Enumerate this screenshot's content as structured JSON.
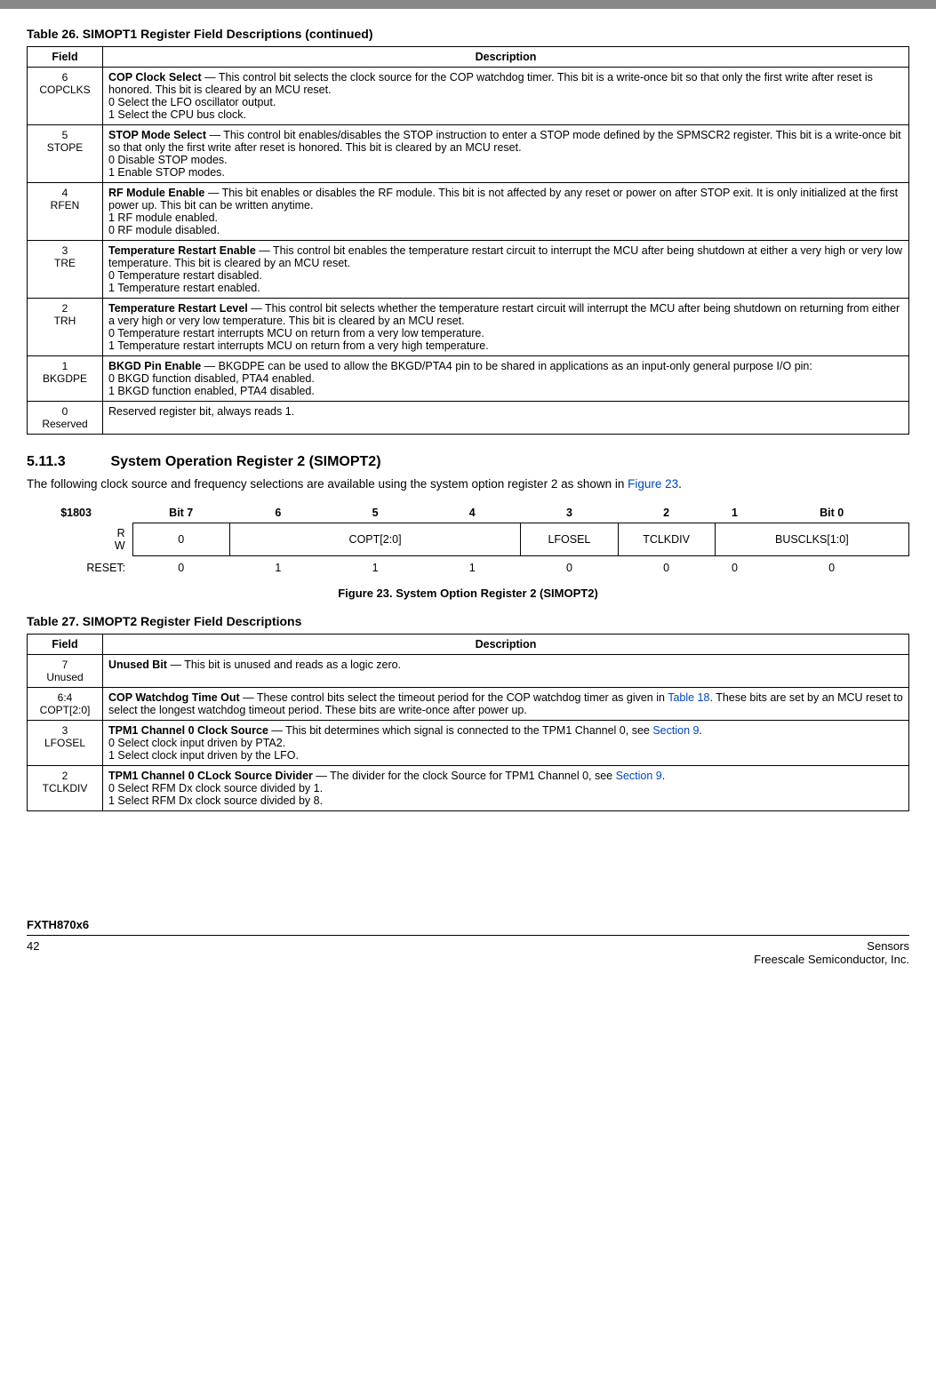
{
  "topbar_title": "",
  "table26_title": "Table 26. SIMOPT1 Register Field Descriptions (continued)",
  "table26_head_field": "Field",
  "table26_head_desc": "Description",
  "rows26": [
    {
      "bit": "6",
      "name": "COPCLKS",
      "title": "COP Clock Select",
      "text": " — This control bit selects the clock source for the COP watchdog timer. This bit is a write-once bit so that only the first write after reset is honored. This bit is cleared by an MCU reset.",
      "opt0": "0   Select the LFO oscillator output.",
      "opt1": "1   Select the CPU bus clock."
    },
    {
      "bit": "5",
      "name": "STOPE",
      "title": "STOP Mode Select",
      "text": " — This control bit enables/disables the STOP instruction to enter a STOP mode defined by the SPMSCR2 register. This bit is a write-once bit so that only the first write after reset is honored. This bit is cleared by an MCU reset.",
      "opt0": "0   Disable STOP modes.",
      "opt1": "1   Enable STOP modes."
    },
    {
      "bit": "4",
      "name": "RFEN",
      "title": "RF Module Enable",
      "text": " — This bit enables or disables the RF module. This bit is not affected by any reset or power on after STOP exit. It is only initialized at the first power up. This bit can be written anytime.",
      "opt0": "1   RF module enabled.",
      "opt1": "0   RF module disabled."
    },
    {
      "bit": "3",
      "name": "TRE",
      "title": "Temperature Restart Enable",
      "text": " — This control bit enables the temperature restart circuit to interrupt the MCU after being shutdown at either a very high or very low temperature. This bit is cleared by an MCU reset.",
      "opt0": "0   Temperature restart disabled.",
      "opt1": "1   Temperature restart enabled."
    },
    {
      "bit": "2",
      "name": "TRH",
      "title": "Temperature Restart Level",
      "text": " — This control bit selects whether the temperature restart circuit will interrupt the MCU after being shutdown on returning from either a very high or very low temperature. This bit is cleared by an MCU reset.",
      "opt0": "0   Temperature restart interrupts MCU on return from a very low temperature.",
      "opt1": "1   Temperature restart interrupts MCU on return from a very high temperature."
    },
    {
      "bit": "1",
      "name": "BKGDPE",
      "title": "BKGD Pin Enable",
      "text": " — BKGDPE can be used to allow the BKGD/PTA4 pin to be shared in applications as an input-only general purpose I/O pin:",
      "opt0": "0   BKGD function disabled, PTA4 enabled.",
      "opt1": "1   BKGD function enabled, PTA4 disabled."
    },
    {
      "bit": "0",
      "name": "Reserved",
      "title": "",
      "text": "Reserved register bit, always reads 1.",
      "opt0": "",
      "opt1": ""
    }
  ],
  "section_num": "5.11.3",
  "section_title": "System Operation Register 2 (SIMOPT2)",
  "section_para_pre": "The following clock source and frequency selections are available using the system option register 2 as shown in ",
  "section_para_link": "Figure 23",
  "section_para_post": ".",
  "bitdiag": {
    "addr": "$1803",
    "bits": [
      "Bit 7",
      "6",
      "5",
      "4",
      "3",
      "2",
      "1",
      "Bit 0"
    ],
    "rlabel": "R",
    "wlabel": "W",
    "cells": [
      "0",
      "COPT[2:0]",
      "LFOSEL",
      "TCLKDIV",
      "BUSCLKS[1:0]"
    ],
    "reset_lbl": "RESET:",
    "reset": [
      "0",
      "1",
      "1",
      "1",
      "0",
      "0",
      "0",
      "0"
    ]
  },
  "fig23_caption": "Figure 23. System Option Register 2 (SIMOPT2)",
  "table27_title": "Table 27. SIMOPT2 Register Field Descriptions",
  "table27_head_field": "Field",
  "table27_head_desc": "Description",
  "rows27": [
    {
      "bit": "7",
      "name": "Unused",
      "title": "Unused Bit",
      "text": " — This bit is unused and reads as a logic zero.",
      "opt0": "",
      "opt1": "",
      "link": ""
    },
    {
      "bit": "6:4",
      "name": "COPT[2:0]",
      "title": "COP Watchdog Time Out",
      "text": " — These control bits select the timeout period for the COP watchdog timer as given in ",
      "link": "Table 18",
      "text2": ". These bits are set by an MCU reset to select the longest watchdog timeout period. These bits are write-once after power up.",
      "opt0": "",
      "opt1": ""
    },
    {
      "bit": "3",
      "name": "LFOSEL",
      "title": "TPM1 Channel 0 Clock Source",
      "text": " — This bit determines which signal is connected to the TPM1 Channel 0, see ",
      "link": "Section 9",
      "text2": ".",
      "opt0": "0   Select clock input driven by PTA2.",
      "opt1": "1   Select clock input driven by the LFO."
    },
    {
      "bit": "2",
      "name": "TCLKDIV",
      "title": "TPM1 Channel 0 CLock Source Divider",
      "text": " — The divider for the clock Source for TPM1 Channel 0, see ",
      "link": "Section 9",
      "text2": ".",
      "opt0": "0   Select RFM Dx clock source divided by 1.",
      "opt1": "1   Select RFM Dx clock source divided by 8."
    }
  ],
  "footer_device": "FXTH870x6",
  "footer_page": "42",
  "footer_right1": "Sensors",
  "footer_right2": "Freescale Semiconductor, Inc."
}
